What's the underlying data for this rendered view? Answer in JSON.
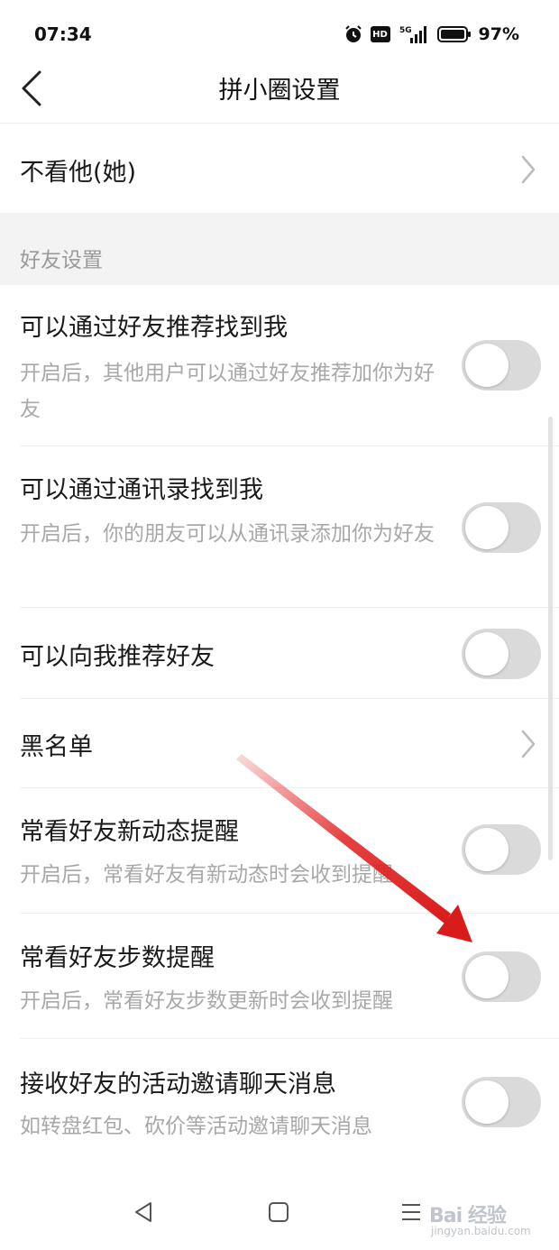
{
  "status_bar": {
    "time": "07:34",
    "network": "5G",
    "hd_label": "HD",
    "battery_pct": "97%",
    "icons": [
      "alarm-icon",
      "hd-icon",
      "signal-icon",
      "battery-icon"
    ]
  },
  "header": {
    "title": "拼小圈设置",
    "back_icon": "chevron-left-icon"
  },
  "block_row": {
    "label": "不看他(她)"
  },
  "section": {
    "label": "好友设置"
  },
  "settings": [
    {
      "title": "可以通过好友推荐找到我",
      "desc": "开启后，其他用户可以通过好友推荐加你为好友",
      "enabled": false
    },
    {
      "title": "可以通过通讯录找到我",
      "desc": "开启后，你的朋友可以从通讯录添加你为好友",
      "enabled": false
    },
    {
      "title": "可以向我推荐好友",
      "desc": "",
      "enabled": false
    },
    {
      "title": "常看好友新动态提醒",
      "desc": "开启后，常看好友有新动态时会收到提醒",
      "enabled": false
    },
    {
      "title": "常看好友步数提醒",
      "desc": "开启后，常看好友步数更新时会收到提醒",
      "enabled": false
    },
    {
      "title": "接收好友的活动邀请聊天消息",
      "desc": "如转盘红包、砍价等活动邀请聊天消息",
      "enabled": false
    }
  ],
  "blacklist_row": {
    "label": "黑名单"
  },
  "colors": {
    "toggle_off": "#dadada",
    "section_bg": "#f3f3f3",
    "annotation_arrow": "#e1201f"
  },
  "bottom_nav": {
    "icons": [
      "back-triangle-icon",
      "home-square-icon",
      "menu-lines-icon"
    ]
  },
  "watermark": {
    "main": "Bai  经验",
    "sub": "jingyan.baidu.com"
  }
}
